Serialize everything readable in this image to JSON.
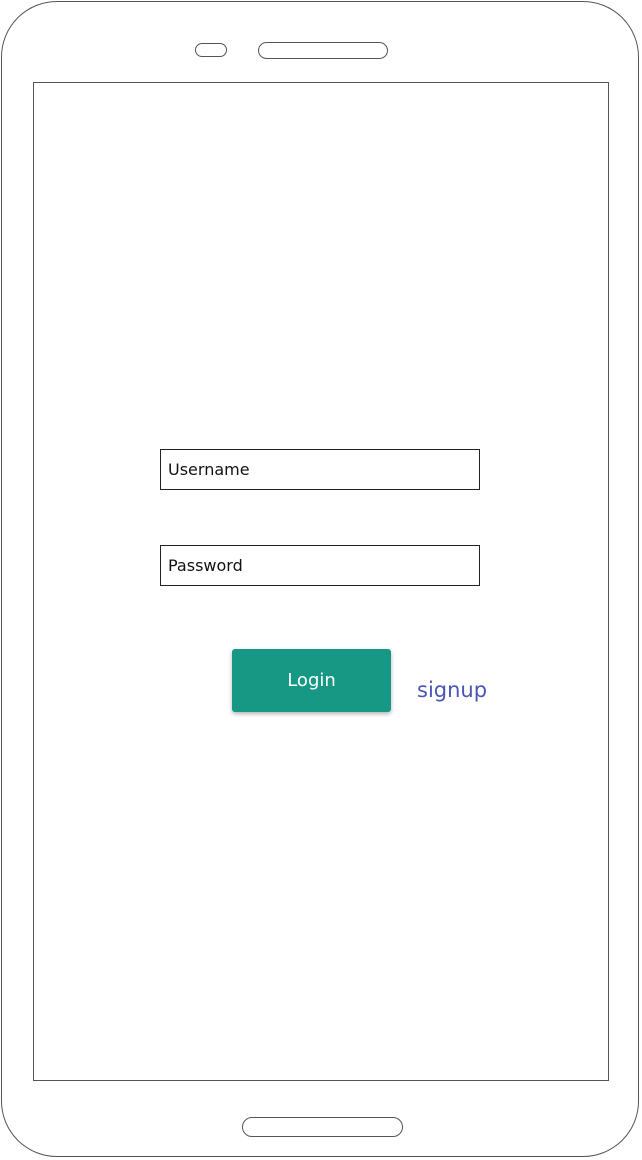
{
  "login_form": {
    "username_placeholder": "Username",
    "password_placeholder": "Password",
    "login_label": "Login",
    "signup_label": "signup"
  },
  "colors": {
    "login_button_bg": "#169884",
    "signup_link": "#4a55b5"
  }
}
